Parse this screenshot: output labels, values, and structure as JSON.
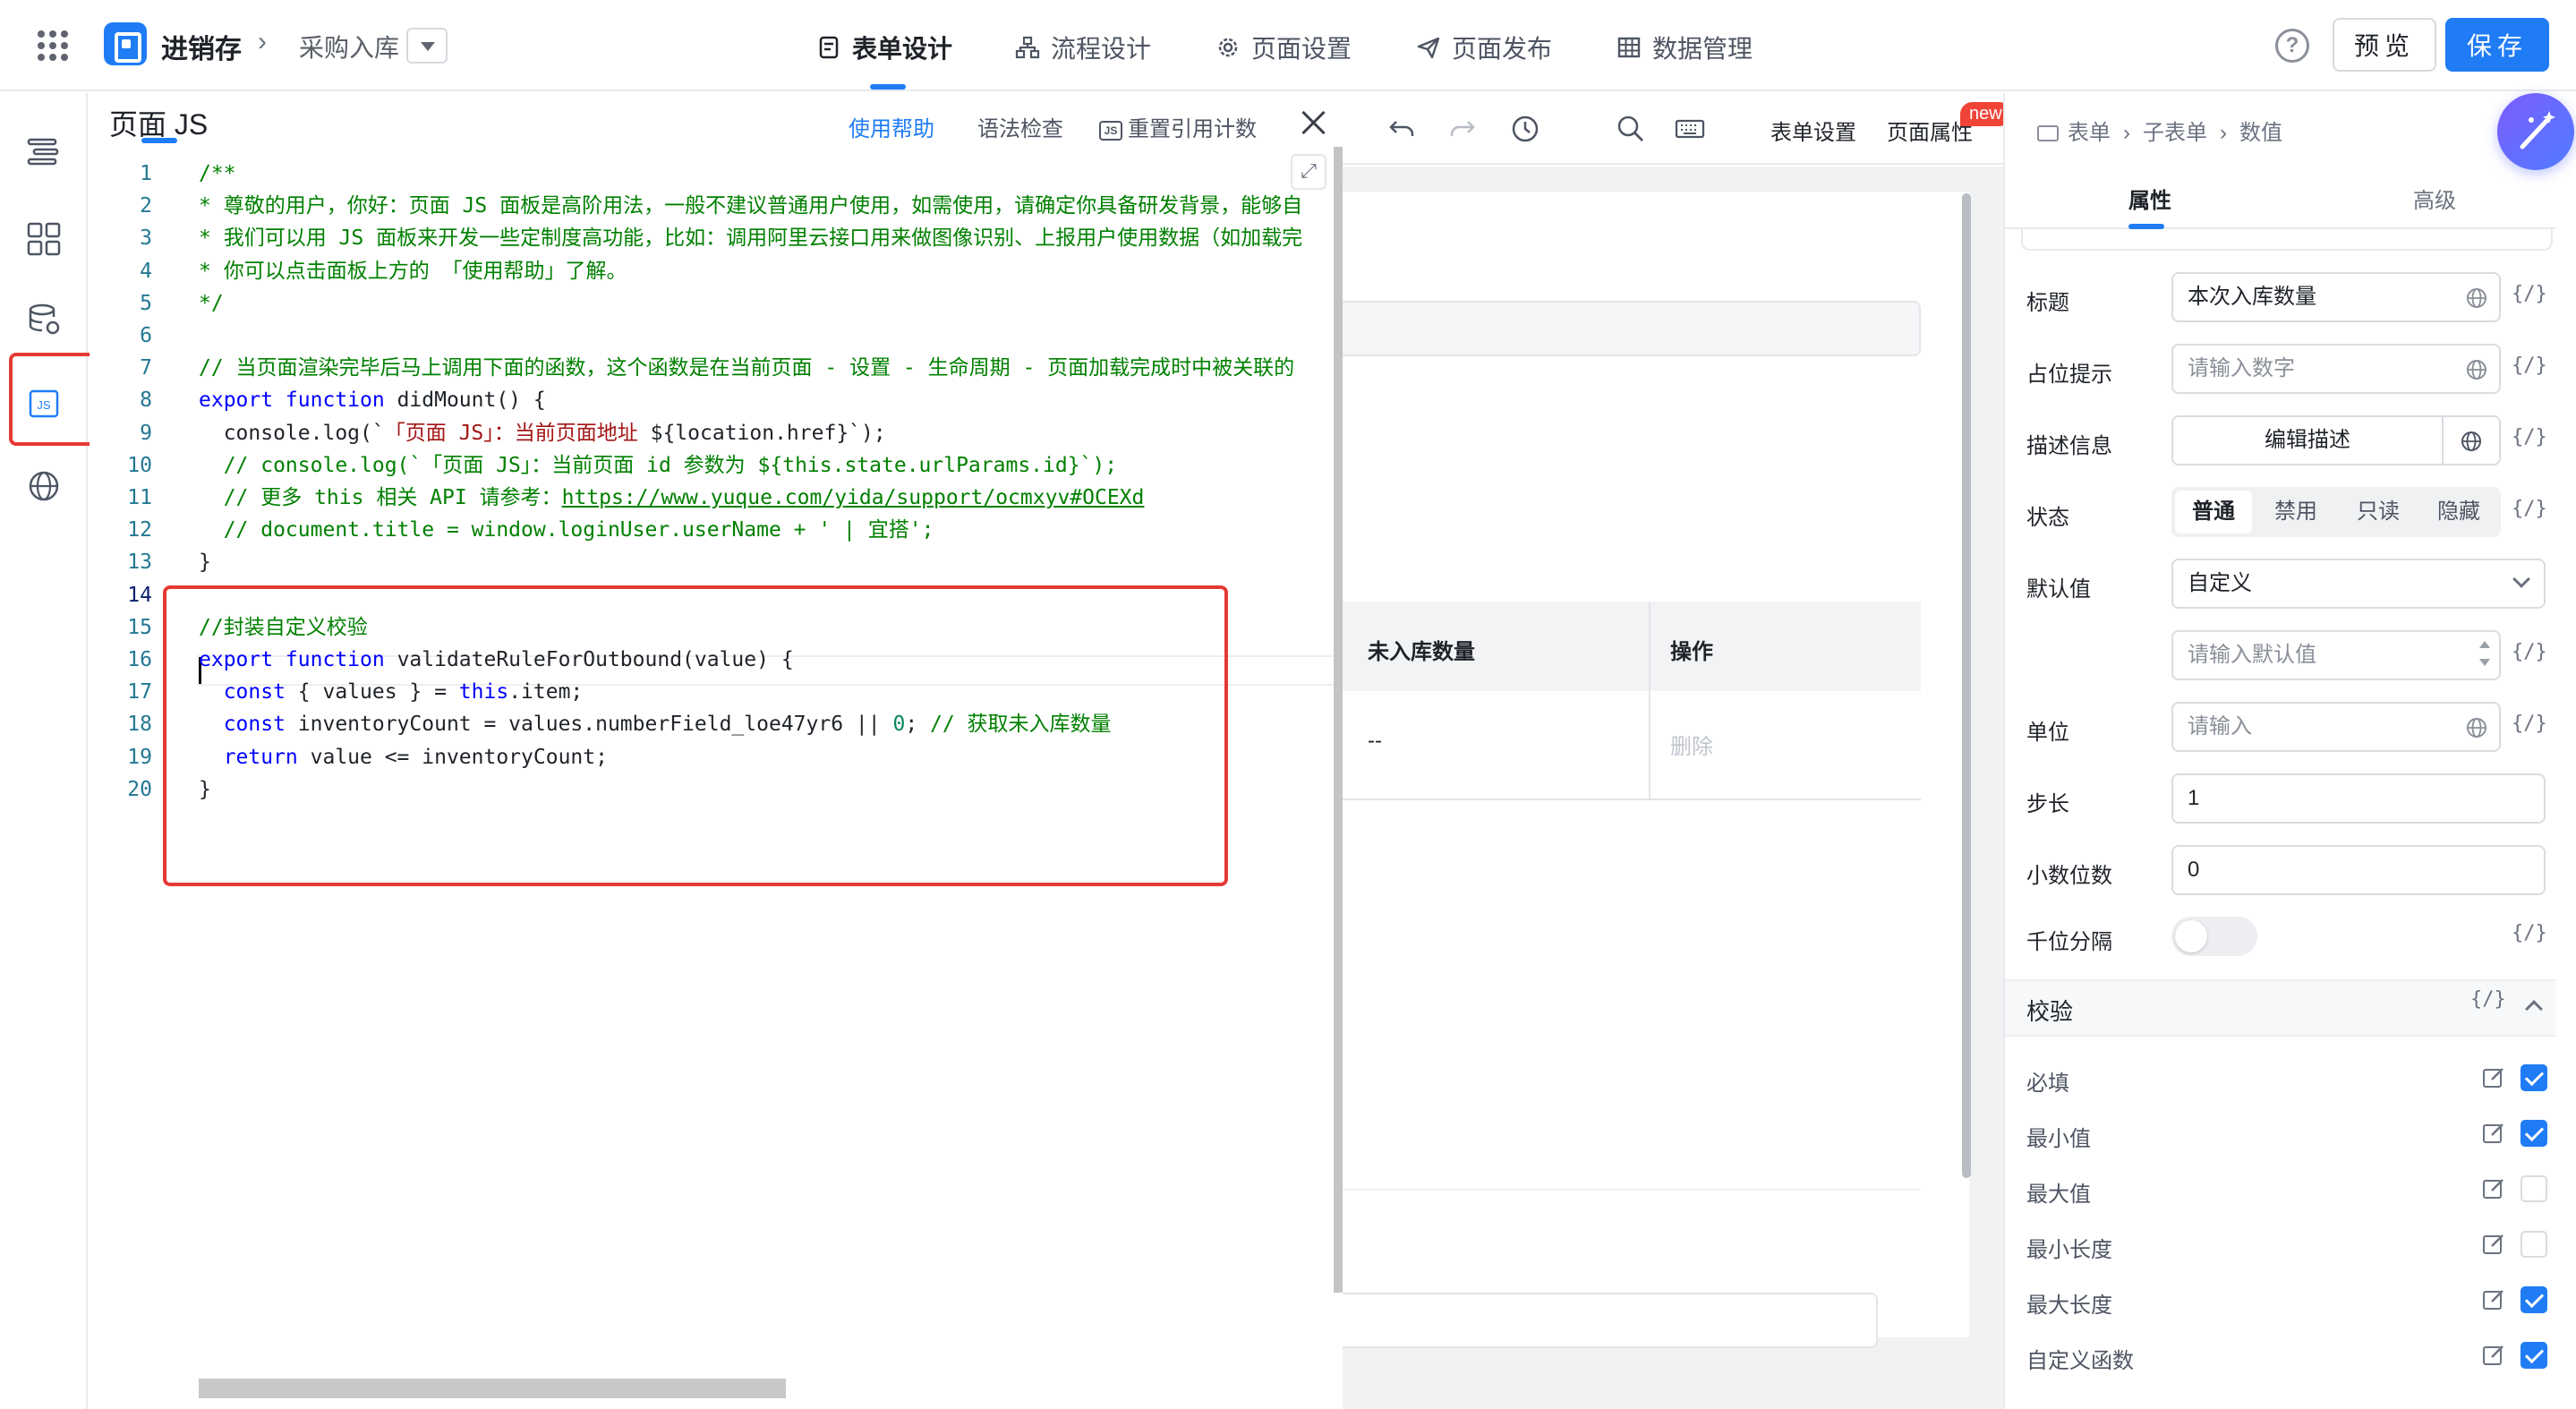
{
  "header": {
    "app_name": "进销存",
    "breadcrumb_sep": "›",
    "page_name": "采购入库",
    "tabs": [
      {
        "label": "表单设计",
        "icon": "form-doc-icon",
        "active": true
      },
      {
        "label": "流程设计",
        "icon": "flow-icon",
        "active": false
      },
      {
        "label": "页面设置",
        "icon": "gear-icon",
        "active": false
      },
      {
        "label": "页面发布",
        "icon": "send-icon",
        "active": false
      },
      {
        "label": "数据管理",
        "icon": "table-grid-icon",
        "active": false
      }
    ],
    "help_label": "?",
    "preview_label": "预览",
    "save_label": "保存"
  },
  "left_rail": {
    "items": [
      "outline-icon",
      "components-icon",
      "datasource-icon",
      "js-icon",
      "globe-icon"
    ],
    "js_label": "JS"
  },
  "js_panel": {
    "title": "页面 JS",
    "help_link": "使用帮助",
    "syntax_check": "语法检查",
    "reset_count": "重置引用计数",
    "reset_badge": "JS",
    "expand_label": "⤢",
    "code_lines": [
      {
        "n": "1",
        "tokens": [
          [
            "c-com",
            "/**"
          ]
        ]
      },
      {
        "n": "2",
        "tokens": [
          [
            "c-com",
            "* 尊敬的用户，你好：页面 JS 面板是高阶用法，一般不建议普通用户使用，如需使用，请确定你具备研发背景，能够自"
          ]
        ]
      },
      {
        "n": "3",
        "tokens": [
          [
            "c-com",
            "* 我们可以用 JS 面板来开发一些定制度高功能，比如：调用阿里云接口用来做图像识别、上报用户使用数据（如加载完"
          ]
        ]
      },
      {
        "n": "4",
        "tokens": [
          [
            "c-com",
            "* 你可以点击面板上方的 「使用帮助」了解。"
          ]
        ]
      },
      {
        "n": "5",
        "tokens": [
          [
            "c-com",
            "*/"
          ]
        ]
      },
      {
        "n": "6",
        "tokens": []
      },
      {
        "n": "7",
        "tokens": [
          [
            "c-com",
            "// 当页面渲染完毕后马上调用下面的函数，这个函数是在当前页面 - 设置 - 生命周期 - 页面加载完成时中被关联的"
          ]
        ]
      },
      {
        "n": "8",
        "tokens": [
          [
            "c-kw",
            "export function "
          ],
          [
            "c-fn",
            "didMount() {"
          ]
        ]
      },
      {
        "n": "9",
        "tokens": [
          [
            "c-fn",
            "  console.log(`"
          ],
          [
            "c-str",
            "「页面 JS」：当前页面地址 "
          ],
          [
            "c-fn",
            "${location.href}`);"
          ]
        ]
      },
      {
        "n": "10",
        "tokens": [
          [
            "c-com",
            "  // console.log(`「页面 JS」：当前页面 id 参数为 ${this.state.urlParams.id}`);"
          ]
        ]
      },
      {
        "n": "11",
        "tokens": [
          [
            "c-com",
            "  // 更多 this 相关 API 请参考："
          ],
          [
            "c-url",
            "https://www.yuque.com/yida/support/ocmxyv#OCEXd"
          ]
        ]
      },
      {
        "n": "12",
        "tokens": [
          [
            "c-com",
            "  // document.title = window.loginUser.userName + ' | 宜搭';"
          ]
        ]
      },
      {
        "n": "13",
        "tokens": [
          [
            "c-fn",
            "}"
          ]
        ]
      },
      {
        "n": "14",
        "tokens": []
      },
      {
        "n": "15",
        "tokens": [
          [
            "c-com",
            "//封装自定义校验"
          ]
        ]
      },
      {
        "n": "16",
        "tokens": [
          [
            "c-kw",
            "export function "
          ],
          [
            "c-fn",
            "validateRuleForOutbound(value) {"
          ]
        ]
      },
      {
        "n": "17",
        "tokens": [
          [
            "c-kw",
            "  const "
          ],
          [
            "c-fn",
            "{ values } = "
          ],
          [
            "c-kw",
            "this"
          ],
          [
            "c-fn",
            ".item;"
          ]
        ]
      },
      {
        "n": "18",
        "tokens": [
          [
            "c-kw",
            "  const "
          ],
          [
            "c-fn",
            "inventoryCount = values.numberField_loe47yr6 || "
          ],
          [
            "c-num",
            "0"
          ],
          [
            "c-fn",
            "; "
          ],
          [
            "c-com",
            "// 获取未入库数量"
          ]
        ]
      },
      {
        "n": "19",
        "tokens": [
          [
            "c-kw",
            "  return "
          ],
          [
            "c-fn",
            "value <= inventoryCount;"
          ]
        ]
      },
      {
        "n": "20",
        "tokens": [
          [
            "c-fn",
            "}"
          ]
        ]
      }
    ]
  },
  "canvas": {
    "toolbar_form_settings": "表单设置",
    "toolbar_page_props": "页面属性",
    "new_badge": "new",
    "table_headers": [
      "未入库数量",
      "操作"
    ],
    "row_values": [
      "--",
      "删除"
    ]
  },
  "props": {
    "breadcrumb": [
      "表单",
      "子表单",
      "数值"
    ],
    "tabs": [
      "属性",
      "高级"
    ],
    "rows": {
      "title_label": "标题",
      "title_value": "本次入库数量",
      "placeholder_label": "占位提示",
      "placeholder_value": "请输入数字",
      "desc_label": "描述信息",
      "desc_button": "编辑描述",
      "state_label": "状态",
      "state_options": [
        "普通",
        "禁用",
        "只读",
        "隐藏"
      ],
      "default_label": "默认值",
      "default_select": "自定义",
      "default_input_placeholder": "请输入默认值",
      "unit_label": "单位",
      "unit_placeholder": "请输入",
      "step_label": "步长",
      "step_value": "1",
      "decimals_label": "小数位数",
      "decimals_value": "0",
      "thousands_label": "千位分隔"
    },
    "fx_label": "{/}",
    "validation": {
      "title": "校验",
      "items": [
        {
          "label": "必填",
          "checked": true
        },
        {
          "label": "最小值",
          "checked": true
        },
        {
          "label": "最大值",
          "checked": false
        },
        {
          "label": "最小长度",
          "checked": false
        },
        {
          "label": "最大长度",
          "checked": true
        },
        {
          "label": "自定义函数",
          "checked": true
        }
      ]
    }
  },
  "colors": {
    "accent": "#1f7cf5",
    "highlight_box": "#e53935",
    "comment": "#008000",
    "keyword": "#0000ff"
  }
}
